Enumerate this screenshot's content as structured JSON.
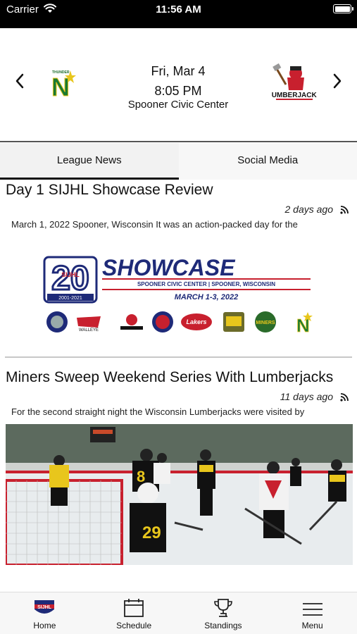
{
  "status_bar": {
    "carrier": "Carrier",
    "time": "11:56 AM"
  },
  "game": {
    "date": "Fri, Mar 4",
    "time": "8:05 PM",
    "venue": "Spooner Civic Center",
    "home_logo_icon": "north-stars-logo",
    "away_logo_icon": "lumberjacks-logo",
    "away_logo_text": "LUMBERJACKS",
    "home_logo_text": "THUNDER",
    "home_logo_letter": "N"
  },
  "tabs": [
    {
      "label": "League News",
      "active": true
    },
    {
      "label": "Social Media",
      "active": false
    }
  ],
  "articles": [
    {
      "headline": "Day 1 SIJHL Showcase Review",
      "ago": "2 days ago",
      "summary": "March 1, 2022 Spooner, Wisconsin It was an action-packed day for the",
      "image": {
        "badge_number": "20",
        "badge_years": "2001-2021",
        "badge_text": "SIJHL",
        "title": "SHOWCASE",
        "subtitle": "SPOONER CIVIC CENTER | SPOONER, WISCONSIN",
        "dates": "MARCH 1-3, 2022"
      }
    },
    {
      "headline": "Miners Sweep Weekend Series With Lumberjacks",
      "ago": "11 days ago",
      "summary": "For the second straight night the Wisconsin Lumberjacks were visited by"
    }
  ],
  "bottom_nav": [
    {
      "label": "Home",
      "icon": "sijhl-logo-icon"
    },
    {
      "label": "Schedule",
      "icon": "calendar-icon"
    },
    {
      "label": "Standings",
      "icon": "trophy-icon"
    },
    {
      "label": "Menu",
      "icon": "hamburger-menu-icon"
    }
  ],
  "colors": {
    "accent": "#1e2a78",
    "red": "#c8202e"
  }
}
